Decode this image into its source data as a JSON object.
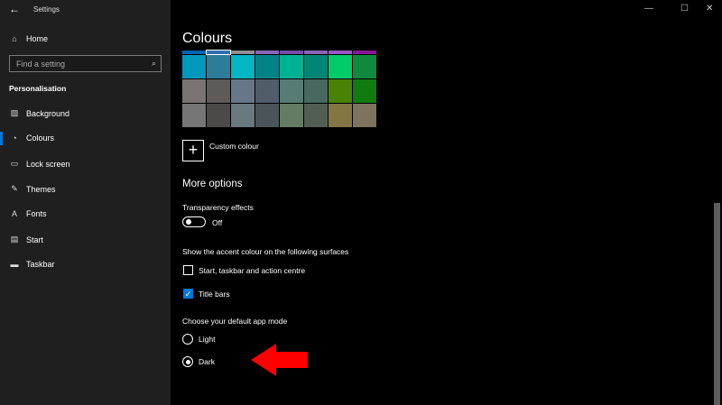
{
  "window": {
    "title": "Settings",
    "back_icon": "←",
    "minimize": "—",
    "maximize": "☐",
    "close": "✕"
  },
  "sidebar": {
    "home": "Home",
    "search_placeholder": "Find a setting",
    "section": "Personalisation",
    "items": [
      {
        "label": "Background"
      },
      {
        "label": "Colours"
      },
      {
        "label": "Lock screen"
      },
      {
        "label": "Themes"
      },
      {
        "label": "Fonts"
      },
      {
        "label": "Start"
      },
      {
        "label": "Taskbar"
      }
    ]
  },
  "main": {
    "title": "Colours",
    "strip_colors": [
      "#0063B1",
      "#2D6FB0",
      "#8E8E8E",
      "#8764B8",
      "#744DA9",
      "#8764B8",
      "#9A56C6",
      "#881798"
    ],
    "swatches": [
      "#0099BC",
      "#2D7D9A",
      "#00B7C3",
      "#038387",
      "#00B294",
      "#018574",
      "#00CC6A",
      "#10893E",
      "#7A7574",
      "#5D5A58",
      "#68768A",
      "#515C6B",
      "#567C73",
      "#486860",
      "#498205",
      "#107C10",
      "#767676",
      "#4C4A48",
      "#69797E",
      "#4A5459",
      "#647C64",
      "#525E54",
      "#847545",
      "#7E735F"
    ],
    "custom_colour": "Custom colour",
    "more_options": "More options",
    "transparency_label": "Transparency effects",
    "transparency_state": "Off",
    "accent_label": "Show the accent colour on the following surfaces",
    "accent_start": "Start, taskbar and action centre",
    "accent_titlebars": "Title bars",
    "mode_label": "Choose your default app mode",
    "mode_light": "Light",
    "mode_dark": "Dark"
  },
  "colors": {
    "accent": "#0078d7",
    "arrow": "#ff0000"
  }
}
